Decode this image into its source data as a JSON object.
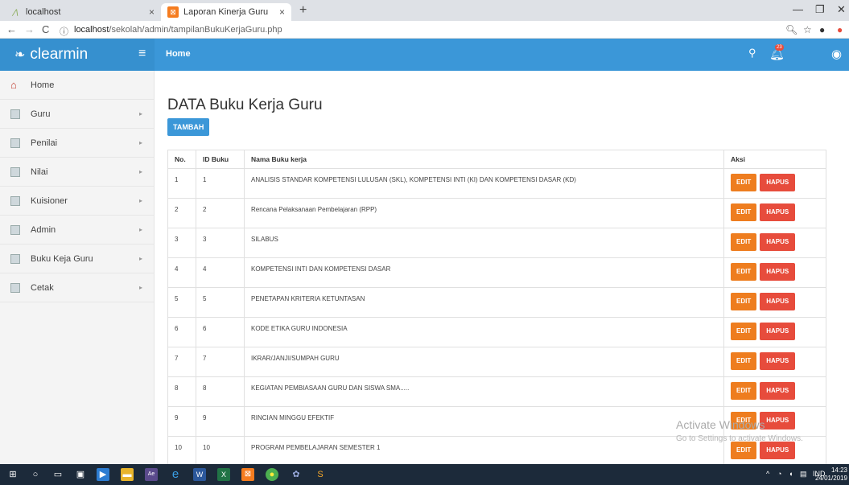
{
  "browser": {
    "tabs": [
      {
        "title": "localhost",
        "icon": "apache-icon"
      },
      {
        "title": "Laporan Kinerja Guru",
        "icon": "xampp-icon"
      }
    ],
    "close_glyph": "×",
    "new_tab_glyph": "+",
    "url_host": "localhost",
    "url_path": "/sekolah/admin/tampilanBukuKerjaGuru.php"
  },
  "app": {
    "brand": "clearmin",
    "breadcrumb": "Home",
    "notification_count": "23"
  },
  "sidebar": {
    "items": [
      {
        "label": "Home",
        "icon": "home-icon",
        "has_submenu": false
      },
      {
        "label": "Guru",
        "icon": "table-icon",
        "has_submenu": true
      },
      {
        "label": "Penilai",
        "icon": "table-icon",
        "has_submenu": true
      },
      {
        "label": "Nilai",
        "icon": "table-icon",
        "has_submenu": true
      },
      {
        "label": "Kuisioner",
        "icon": "table-icon",
        "has_submenu": true
      },
      {
        "label": "Admin",
        "icon": "table-icon",
        "has_submenu": true
      },
      {
        "label": "Buku Keja Guru",
        "icon": "table-icon",
        "has_submenu": true
      },
      {
        "label": "Cetak",
        "icon": "table-icon",
        "has_submenu": true
      }
    ]
  },
  "main": {
    "title": "DATA Buku Kerja Guru",
    "add_label": "TAMBAH",
    "table": {
      "headers": [
        "No.",
        "ID Buku",
        "Nama Buku kerja",
        "Aksi"
      ],
      "edit_label": "EDIT",
      "delete_label": "HAPUS",
      "rows": [
        {
          "no": "1",
          "id": "1",
          "name": "ANALISIS STANDAR KOMPETENSI LULUSAN (SKL), KOMPETENSI INTI (KI) DAN KOMPETENSI DASAR (KD)"
        },
        {
          "no": "2",
          "id": "2",
          "name": "Rencana Pelaksanaan Pembelajaran (RPP)"
        },
        {
          "no": "3",
          "id": "3",
          "name": "SILABUS"
        },
        {
          "no": "4",
          "id": "4",
          "name": "KOMPETENSI INTI DAN KOMPETENSI DASAR"
        },
        {
          "no": "5",
          "id": "5",
          "name": "PENETAPAN KRITERIA KETUNTASAN"
        },
        {
          "no": "6",
          "id": "6",
          "name": "KODE ETIKA GURU INDONESIA"
        },
        {
          "no": "7",
          "id": "7",
          "name": "IKRAR/JANJI/SUMPAH GURU"
        },
        {
          "no": "8",
          "id": "8",
          "name": "KEGIATAN PEMBIASAAN GURU DAN SISWA SMA....."
        },
        {
          "no": "9",
          "id": "9",
          "name": "RINCIAN MINGGU EFEKTIF"
        },
        {
          "no": "10",
          "id": "10",
          "name": "PROGRAM PEMBELAJARAN SEMESTER 1"
        }
      ]
    }
  },
  "watermark": {
    "line1": "Activate Windows",
    "line2": "Go to Settings to activate Windows."
  },
  "taskbar": {
    "language": "IND",
    "time": "14:23",
    "date": "24/01/2019"
  },
  "colors": {
    "primary": "#3b97d8",
    "edit": "#ee7d1f",
    "delete": "#e74c3c"
  }
}
